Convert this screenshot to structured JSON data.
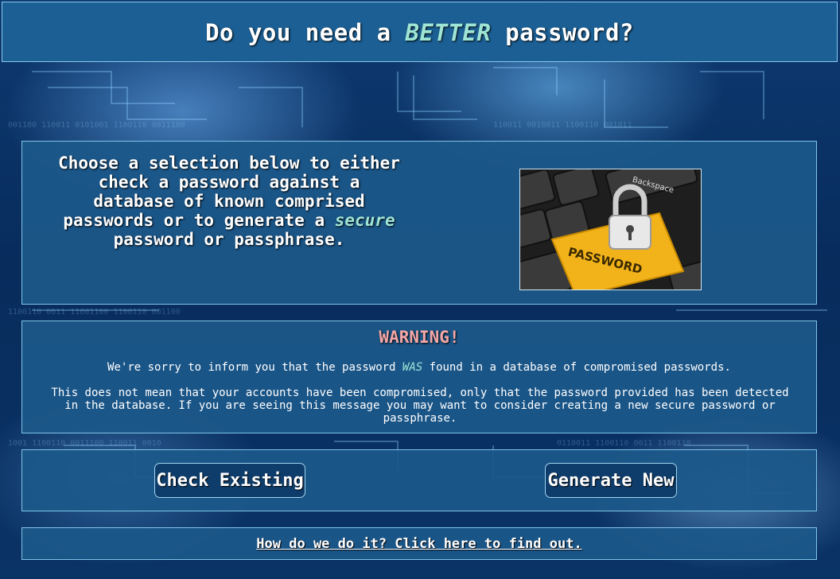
{
  "header": {
    "title_part1": "Do you need a ",
    "title_emphasis": "BETTER",
    "title_part2": " password?"
  },
  "intro": {
    "text_part1": "Choose a selection below to either check a password against a database of known comprised passwords or to generate a ",
    "text_emphasis": "secure",
    "text_part2": " password or passphrase.",
    "image": {
      "keyboard_key_label": "PASSWORD",
      "keyboard_backspace_label": "Backspace"
    }
  },
  "warning": {
    "title": "WARNING!",
    "message1_part1": "We're sorry to inform you that the password ",
    "message1_emphasis": "WAS",
    "message1_part2": " found in a database of compromised passwords.",
    "message2": "This does not mean that your accounts have been compromised, only that the password provided has been detected in the database. If you are seeing this message you may want to consider creating a new secure password or passphrase."
  },
  "actions": {
    "check_label": "Check Existing",
    "generate_label": "Generate New"
  },
  "footer": {
    "link_text": "How do we do it? Click here to find out."
  },
  "colors": {
    "panel": "#1c588a",
    "accent": "#9fe5d6",
    "warning": "#f4a7a7",
    "button": "#0f3d6b"
  }
}
